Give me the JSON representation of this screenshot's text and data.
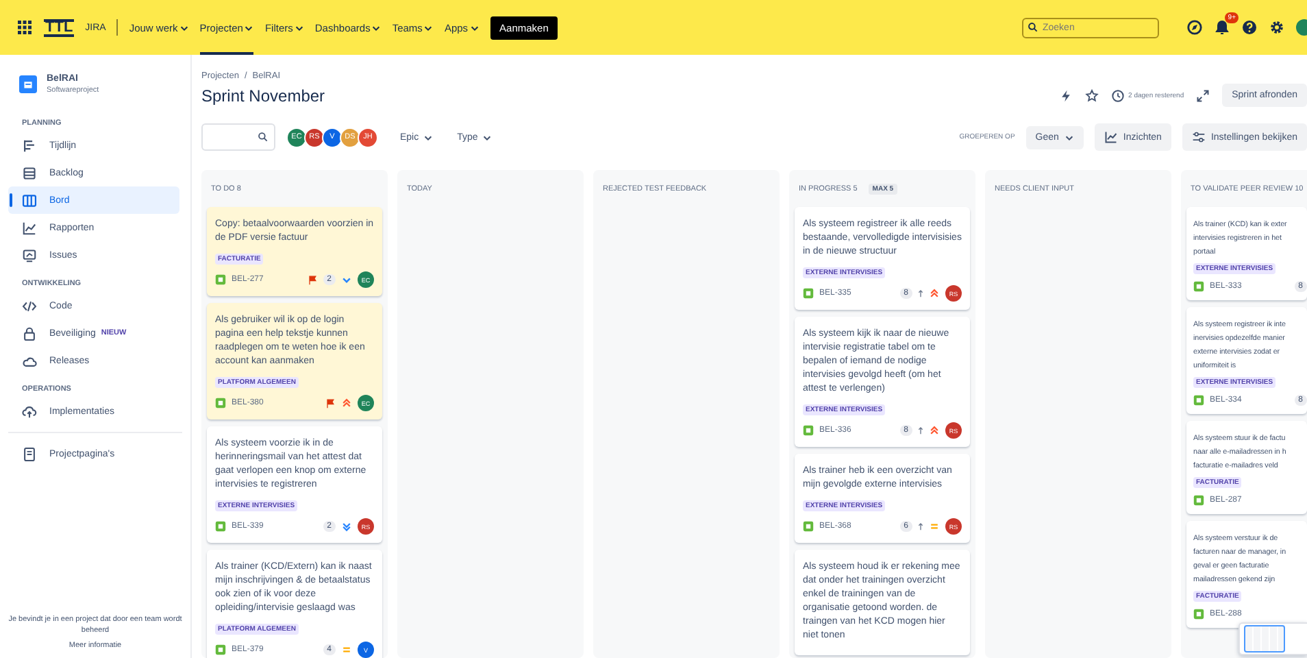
{
  "topbar": {
    "logo": "TTL",
    "product": "JIRA",
    "nav": [
      {
        "label": "Jouw werk",
        "selected": false
      },
      {
        "label": "Projecten",
        "selected": true
      },
      {
        "label": "Filters",
        "selected": false
      },
      {
        "label": "Dashboards",
        "selected": false
      },
      {
        "label": "Teams",
        "selected": false
      },
      {
        "label": "Apps",
        "selected": false
      }
    ],
    "create_button": "Aanmaken",
    "search": {
      "placeholder": "Zoeken"
    },
    "notification_badge": "9+"
  },
  "sidebar": {
    "project": {
      "name": "BelRAI",
      "type": "Softwareproject"
    },
    "sections": [
      {
        "heading": "PLANNING",
        "items": [
          {
            "label": "Tijdlijn",
            "selected": false
          },
          {
            "label": "Backlog",
            "selected": false
          },
          {
            "label": "Bord",
            "selected": true
          },
          {
            "label": "Rapporten",
            "selected": false
          },
          {
            "label": "Issues",
            "selected": false
          }
        ]
      },
      {
        "heading": "ONTWIKKELING",
        "items": [
          {
            "label": "Code",
            "selected": false
          },
          {
            "label": "Beveiliging",
            "badge": "NIEUW",
            "selected": false
          },
          {
            "label": "Releases",
            "selected": false
          }
        ]
      },
      {
        "heading": "OPERATIONS",
        "items": [
          {
            "label": "Implementaties",
            "selected": false
          }
        ]
      }
    ],
    "pages_item": "Projectpagina's",
    "footer_text": "Je bevindt je in een project dat door een team wordt beheerd",
    "footer_link": "Meer informatie"
  },
  "header": {
    "breadcrumb": [
      "Projecten",
      "BelRAI"
    ],
    "breadcrumb_separator": "/",
    "title": "Sprint November",
    "remaining": "2 dagen resterend",
    "complete_button": "Sprint afronden"
  },
  "toolbar": {
    "avatars": [
      {
        "initials": "EC",
        "color": "#1f845a"
      },
      {
        "initials": "RS",
        "color": "#c9372c"
      },
      {
        "initials": "V",
        "color": "#0c66e4"
      },
      {
        "initials": "DS",
        "color": "#e2a03f"
      },
      {
        "initials": "JH",
        "color": "#e34935"
      }
    ],
    "filters": [
      "Epic",
      "Type"
    ],
    "group_label": "GROEPEREN OP",
    "group_value": "Geen",
    "insights_button": "Inzichten",
    "settings_button": "Instellingen bekijken"
  },
  "columns": [
    {
      "title": "TO DO 8",
      "cards": [
        {
          "title": "Copy: betaalvoorwaarden voorzien in de PDF versie factuur",
          "label": "FACTURATIE",
          "key": "BEL-277",
          "flagged": true,
          "estimate": "2",
          "priority": {
            "kind": "low"
          },
          "assignee": {
            "initials": "EC",
            "color": "#1f845a"
          }
        },
        {
          "title": "Als gebruiker wil ik op de login pagina een help tekstje kunnen raadplegen om te weten hoe ik een account kan aanmaken",
          "label": "PLATFORM ALGEMEEN",
          "key": "BEL-380",
          "flagged": true,
          "priority": {
            "kind": "high"
          },
          "assignee": {
            "initials": "EC",
            "color": "#1f845a"
          }
        },
        {
          "title": "Als systeem voorzie ik in de herinneringsmail van het attest dat gaat verlopen een knop om externe intervisies te registreren",
          "label": "EXTERNE INTERVISIES",
          "key": "BEL-339",
          "flagged": false,
          "estimate": "2",
          "priority": {
            "kind": "lowest"
          },
          "assignee": {
            "initials": "RS",
            "color": "#c9372c"
          }
        },
        {
          "title": "Als trainer (KCD/Extern) kan ik naast mijn inschrijvingen & de betaalstatus ook zien of ik voor deze opleiding/intervisie geslaagd was",
          "label": "PLATFORM ALGEMEEN",
          "key": "BEL-379",
          "flagged": false,
          "estimate": "4",
          "priority": {
            "kind": "medium"
          },
          "assignee": {
            "initials": "V",
            "color": "#0c66e4"
          }
        }
      ]
    },
    {
      "title": "TODAY"
    },
    {
      "title": "REJECTED TEST FEEDBACK"
    },
    {
      "title": "IN PROGRESS 5",
      "limit": "MAX 5",
      "cards": [
        {
          "title": "Als systeem registreer ik alle reeds bestaande, vervolledigde intervisisies in de nieuwe structuur",
          "label": "EXTERNE INTERVISIES",
          "key": "BEL-335",
          "flagged": false,
          "estimate": "8",
          "subtasks": true,
          "priority": {
            "kind": "high"
          },
          "assignee": {
            "initials": "RS",
            "color": "#c9372c"
          }
        },
        {
          "title": "Als systeem kijk ik naar de nieuwe intervisie registratie tabel om te bepalen of iemand de nodige intervisies gevolgd heeft (om het attest te verlengen)",
          "label": "EXTERNE INTERVISIES",
          "key": "BEL-336",
          "flagged": false,
          "estimate": "8",
          "subtasks": true,
          "priority": {
            "kind": "high"
          },
          "assignee": {
            "initials": "RS",
            "color": "#c9372c"
          }
        },
        {
          "title": "Als trainer heb ik een overzicht van mijn gevolgde externe intervisies",
          "label": "EXTERNE INTERVISIES",
          "key": "BEL-368",
          "flagged": false,
          "estimate": "6",
          "subtasks": true,
          "priority": {
            "kind": "medium"
          },
          "assignee": {
            "initials": "RS",
            "color": "#c9372c"
          }
        },
        {
          "title": "Als systeem houd ik er rekening mee dat onder het trainingen overzicht enkel de trainingen van de organisatie getoond worden. de traingen van het KCD mogen hier niet tonen"
        }
      ]
    },
    {
      "title": "NEEDS CLIENT INPUT"
    },
    {
      "title": "TO VALIDATE PEER REVIEW 10",
      "cards": [
        {
          "lines": [
            "Als trainer (KCD) kan ik exter",
            "intervisies registreren in het",
            "portaal"
          ],
          "label": "EXTERNE INTERVISIES",
          "key": "BEL-333",
          "flagged": false,
          "estimate": "8"
        },
        {
          "lines": [
            "Als systeem registreer ik inte",
            "inervisies opdezelfde manier",
            "externe intervisies zodat er",
            "uniformiteit is"
          ],
          "label": "EXTERNE INTERVISIES",
          "key": "BEL-334",
          "flagged": false,
          "estimate": "8"
        },
        {
          "lines": [
            "Als systeem stuur ik de factu",
            "naar alle e-mailadressen in h",
            "facturatie e-mailadres veld"
          ],
          "label": "FACTURATIE",
          "key": "BEL-287",
          "flagged": false
        },
        {
          "lines": [
            "Als systeem verstuur ik de",
            "facturen naar de manager, in",
            "geval er geen facturatie",
            "mailadressen gekend zijn"
          ],
          "label": "FACTURATIE",
          "key": "BEL-288",
          "flagged": false
        }
      ]
    }
  ]
}
